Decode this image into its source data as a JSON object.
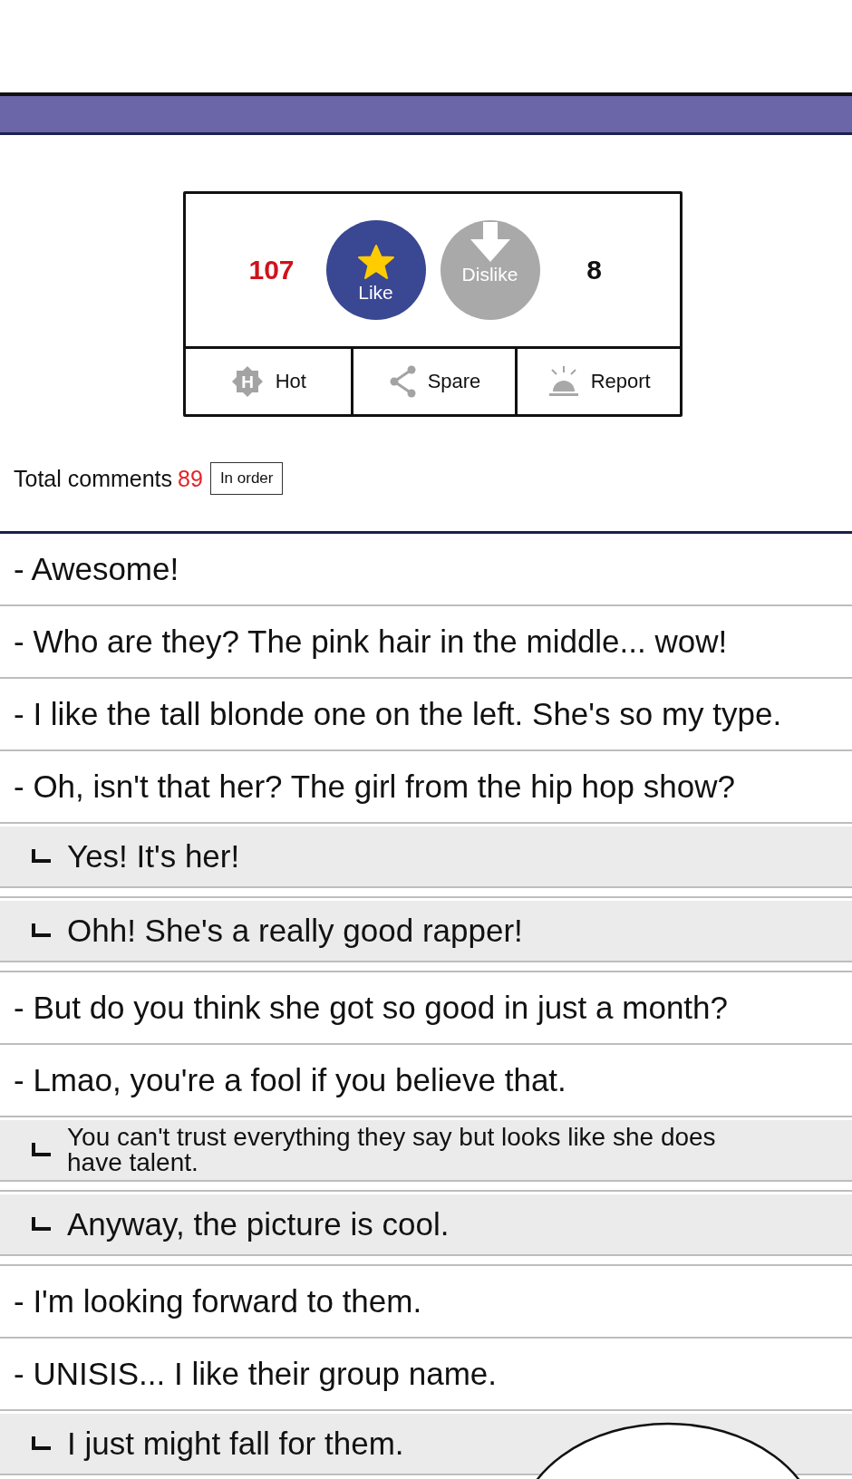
{
  "vote_panel": {
    "votes": [
      {
        "kind": "like",
        "count": "107",
        "label": "Like"
      },
      {
        "kind": "dislike",
        "count": "8",
        "label": "Dislike"
      }
    ],
    "actions": [
      {
        "kind": "hot",
        "label": "Hot",
        "badge_letter": "H"
      },
      {
        "kind": "share",
        "label": "Spare"
      },
      {
        "kind": "report",
        "label": "Report"
      }
    ]
  },
  "comments_header": {
    "label": "Total comments",
    "count": "89",
    "sort_button": "In order"
  },
  "comments": [
    {
      "text": "- Awesome!"
    },
    {
      "text": "- Who are they? The pink hair in the middle... wow!"
    },
    {
      "text": "- I like the tall blonde one on the left. She's so my type."
    },
    {
      "text": "- Oh, isn't that her? The girl from the hip hop show?",
      "children": [
        {
          "text": "Yes! It's her!"
        },
        {
          "text": "Ohh! She's a really good rapper!"
        }
      ]
    },
    {
      "text": "- But do you think she got so good in just a month?"
    },
    {
      "text": "- Lmao, you're a fool if you believe that.",
      "children": [
        {
          "text": "You can't trust everything they say but looks like she does have talent."
        },
        {
          "text": "Anyway, the picture is cool."
        }
      ]
    },
    {
      "text": "- I'm looking forward to them."
    },
    {
      "text": "- UNISIS... I like their group name.",
      "children": [
        {
          "text": "I just might fall for them."
        }
      ]
    }
  ]
}
